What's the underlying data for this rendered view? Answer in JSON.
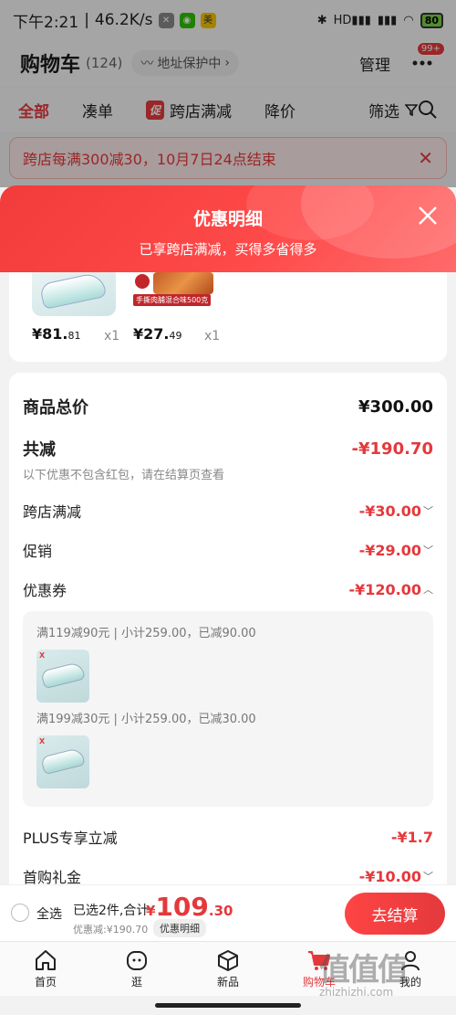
{
  "status_bar": {
    "time": "下午2:21",
    "network_speed": "46.2K/s",
    "battery": "80"
  },
  "header": {
    "title": "购物车",
    "count": "(124)",
    "address_protect": "地址保护中",
    "manage": "管理",
    "badge": "99+"
  },
  "tabs": [
    {
      "label": "全部",
      "active": true
    },
    {
      "label": "凑单",
      "active": false
    },
    {
      "label": "跨店满减",
      "tag": "促",
      "active": false
    },
    {
      "label": "降价",
      "active": false
    },
    {
      "label": "筛选",
      "active": false
    }
  ],
  "notice": {
    "text": "跨店每满300减30，10月7日24点结束"
  },
  "sheet": {
    "title": "优惠明细",
    "subtitle": "已享跨店满减，买得多省得多"
  },
  "products": [
    {
      "price_int": "¥81.",
      "price_dec": "81",
      "qty": "x1"
    },
    {
      "price_int": "¥27.",
      "price_dec": "49",
      "qty": "x1",
      "image_label": "手撕肉脯混合味500克"
    }
  ],
  "detail": {
    "subtotal_label": "商品总价",
    "subtotal_value": "¥300.00",
    "total_discount_label": "共减",
    "total_discount_value": "-¥190.70",
    "note": "以下优惠不包含红包，请在结算页查看",
    "items": [
      {
        "label": "跨店满减",
        "value": "-¥30.00",
        "chevron": "down"
      },
      {
        "label": "促销",
        "value": "-¥29.00",
        "chevron": "down"
      },
      {
        "label": "优惠券",
        "value": "-¥120.00",
        "chevron": "up"
      }
    ],
    "coupons": [
      {
        "text": "满119减90元 | 小计259.00，已减90.00"
      },
      {
        "text": "满199减30元 | 小计259.00，已减30.00"
      }
    ],
    "plus_label": "PLUS专享立减",
    "plus_value": "-¥1.7",
    "first_buy_label": "首购礼金",
    "first_buy_value": "-¥10.00"
  },
  "checkout": {
    "select_all": "全选",
    "selected": "已选2件,合计:",
    "yen": "¥",
    "total_int": "109",
    "total_dec": ".30",
    "saved": "优惠减:¥190.70",
    "detail_btn": "优惠明细",
    "checkout_btn": "去结算"
  },
  "tabbar": [
    {
      "label": "首页",
      "icon": "home-icon"
    },
    {
      "label": "逛",
      "icon": "face-icon"
    },
    {
      "label": "新品",
      "icon": "box-icon"
    },
    {
      "label": "购物车",
      "icon": "cart-icon",
      "active": true
    },
    {
      "label": "我的",
      "icon": "user-icon"
    }
  ],
  "watermark": {
    "zh": "值值值",
    "en": "zhizhizhi.com"
  },
  "colors": {
    "accent": "#e4393c",
    "background": "#f2f2f2"
  }
}
